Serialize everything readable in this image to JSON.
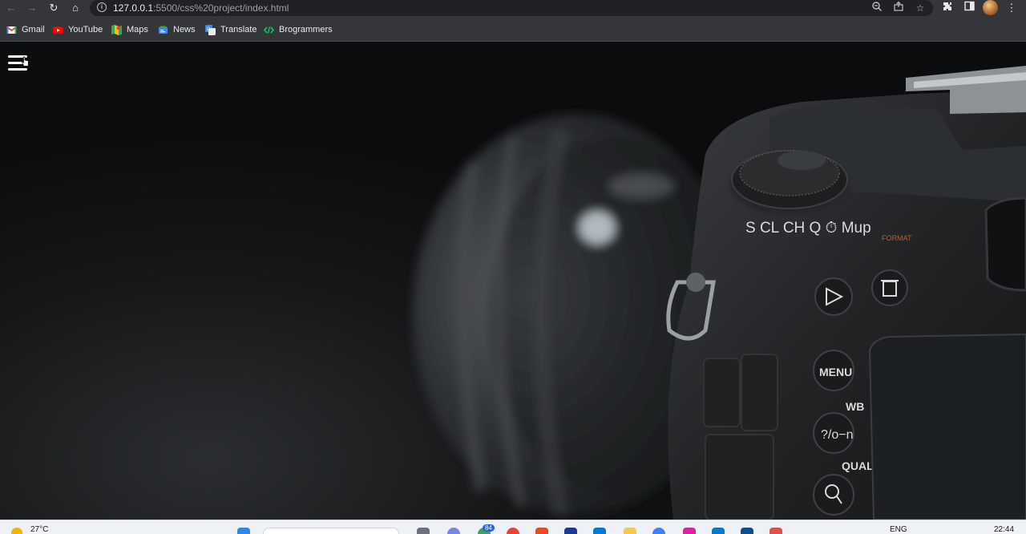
{
  "browser": {
    "url_host": "127.0.0.1",
    "url_path": ":5500/css%20project/index.html"
  },
  "bookmarks": [
    {
      "label": "Gmail",
      "icon": "gmail-icon",
      "color": "#ea4335"
    },
    {
      "label": "YouTube",
      "icon": "youtube-icon",
      "color": "#ff0000"
    },
    {
      "label": "Maps",
      "icon": "maps-icon",
      "color": "#34a853"
    },
    {
      "label": "News",
      "icon": "news-icon",
      "color": "#4285f4"
    },
    {
      "label": "Translate",
      "icon": "translate-icon",
      "color": "#4285f4"
    },
    {
      "label": "Brogrammers",
      "icon": "code-icon",
      "color": "#0fcf6f"
    }
  ],
  "camera_labels": {
    "menu": "MENU",
    "wb": "WB",
    "help_lock": "?/o−n",
    "qual": "QUAL",
    "format": "FORMAT",
    "dial_modes": "S  CL CH  Q  ⏱  Mup"
  },
  "taskbar": {
    "weather_temp": "27°C",
    "badge_count": "84",
    "language": "ENG",
    "time": "22:44"
  },
  "colors": {
    "toolbar": "#35363a",
    "omnibox": "#202124",
    "page_bg": "#0b0c0d"
  }
}
